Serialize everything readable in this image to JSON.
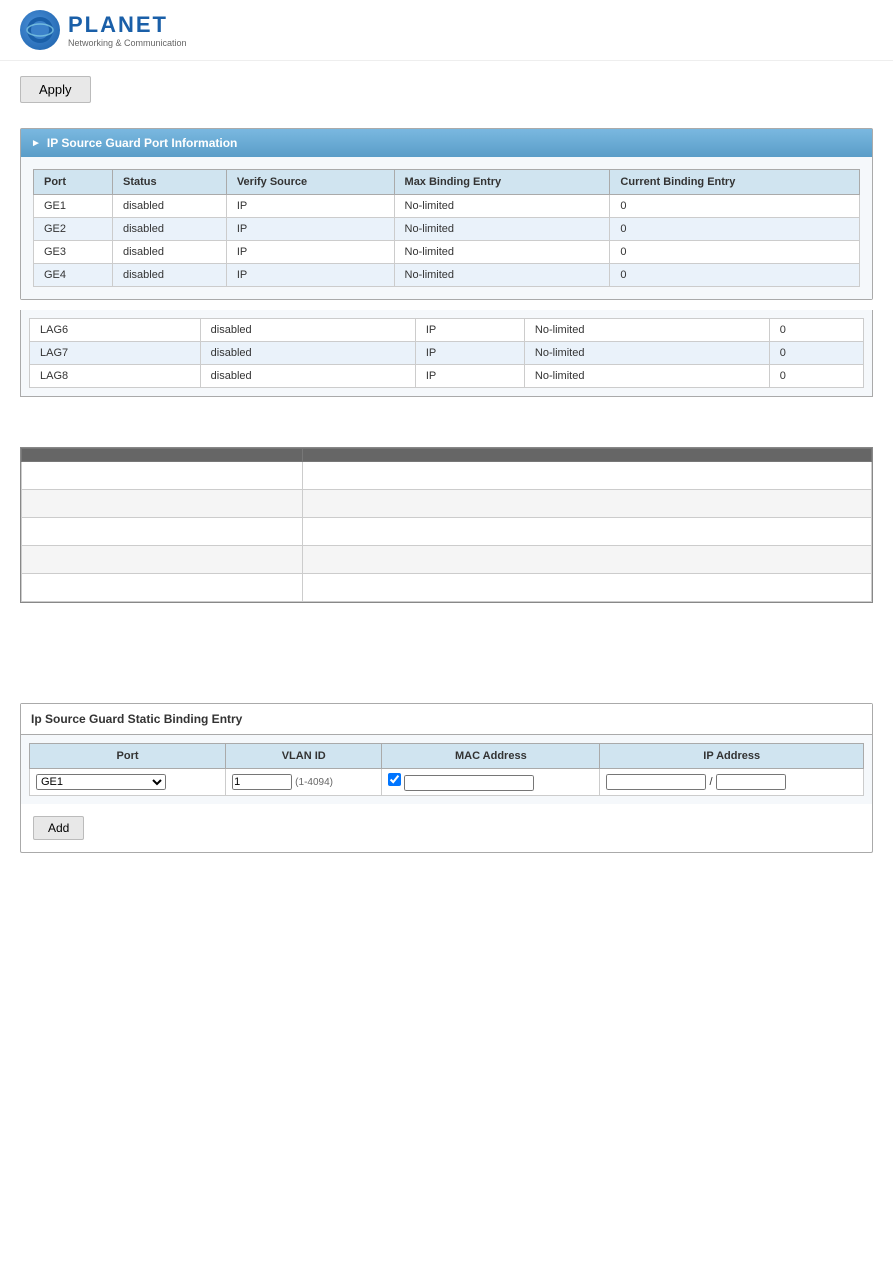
{
  "logo": {
    "brand": "PLANET",
    "subtitle": "Networking & Communication"
  },
  "toolbar": {
    "apply_label": "Apply"
  },
  "port_info_section": {
    "title": "IP Source Guard Port Information",
    "table": {
      "headers": [
        "Port",
        "Status",
        "Verify Source",
        "Max Binding Entry",
        "Current Binding Entry"
      ],
      "rows": [
        [
          "GE1",
          "disabled",
          "IP",
          "No-limited",
          "0"
        ],
        [
          "GE2",
          "disabled",
          "IP",
          "No-limited",
          "0"
        ],
        [
          "GE3",
          "disabled",
          "IP",
          "No-limited",
          "0"
        ],
        [
          "GE4",
          "disabled",
          "IP",
          "No-limited",
          "0"
        ]
      ]
    }
  },
  "lag_table": {
    "rows": [
      [
        "LAG6",
        "disabled",
        "IP",
        "No-limited",
        "0"
      ],
      [
        "LAG7",
        "disabled",
        "IP",
        "No-limited",
        "0"
      ],
      [
        "LAG8",
        "disabled",
        "IP",
        "No-limited",
        "0"
      ]
    ]
  },
  "mid_section": {
    "col1_header": "",
    "col2_header": "",
    "rows": [
      [
        "",
        ""
      ],
      [
        "",
        ""
      ],
      [
        "",
        ""
      ],
      [
        "",
        ""
      ],
      [
        "",
        ""
      ]
    ]
  },
  "static_binding": {
    "title": "Ip Source Guard Static Binding Entry",
    "headers": [
      "Port",
      "VLAN ID",
      "MAC Address",
      "IP Address"
    ],
    "form": {
      "port_default": "GE1",
      "vlan_default": "1",
      "vlan_hint": "(1-4094)",
      "mac_placeholder": "",
      "ip_placeholder": "",
      "add_label": "Add"
    }
  }
}
